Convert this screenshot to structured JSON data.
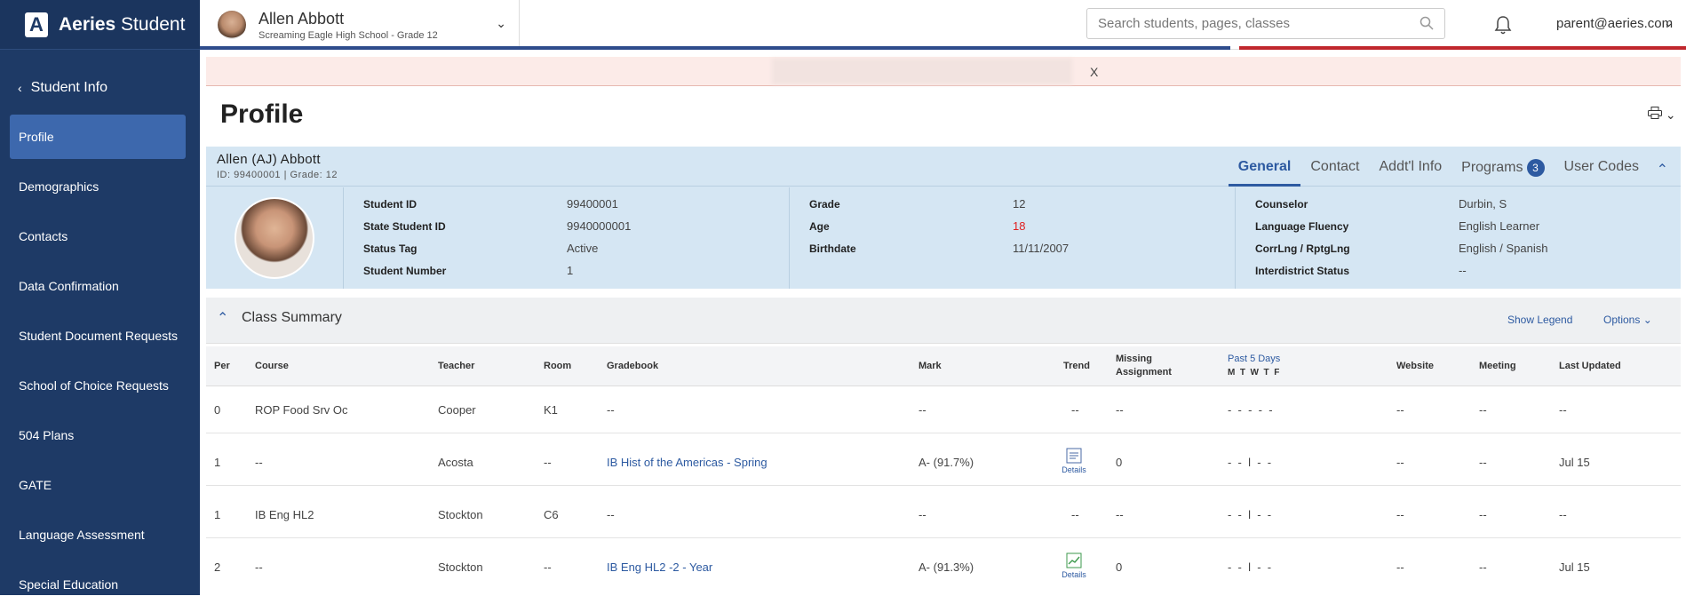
{
  "app": {
    "logo_letter": "A",
    "name_bold": "Aeries",
    "name_rest": " Student"
  },
  "sidebar": {
    "back_label": "Student Info",
    "items": [
      {
        "label": "Profile",
        "active": true
      },
      {
        "label": "Demographics"
      },
      {
        "label": "Contacts"
      },
      {
        "label": "Data Confirmation"
      },
      {
        "label": "Student Document Requests"
      },
      {
        "label": "School of Choice Requests"
      },
      {
        "label": "504 Plans"
      },
      {
        "label": "GATE"
      },
      {
        "label": "Language Assessment"
      },
      {
        "label": "Special Education"
      }
    ]
  },
  "header": {
    "student_name": "Allen Abbott",
    "student_sub": "Screaming Eagle High School - Grade 12",
    "search_placeholder": "Search students, pages, classes",
    "user_email": "parent@aeries.com"
  },
  "alert": {
    "close": "X"
  },
  "page": {
    "title": "Profile"
  },
  "card": {
    "name": "Allen (AJ) Abbott",
    "id_line": "ID: 99400001 |  Grade: 12",
    "tabs": [
      "General",
      "Contact",
      "Addt'l Info",
      "Programs",
      "User Codes"
    ],
    "programs_count": "3",
    "col1": [
      {
        "label": "Student ID",
        "value": "99400001"
      },
      {
        "label": "State Student ID",
        "value": "9940000001"
      },
      {
        "label": "Status Tag",
        "value": "Active"
      },
      {
        "label": "Student Number",
        "value": "1"
      }
    ],
    "col2": [
      {
        "label": "Grade",
        "value": "12"
      },
      {
        "label": "Age",
        "value": "18"
      },
      {
        "label": "Birthdate",
        "value": "11/11/2007"
      }
    ],
    "col3": [
      {
        "label": "Counselor",
        "value": "Durbin, S"
      },
      {
        "label": "Language Fluency",
        "value": "English Learner"
      },
      {
        "label": "CorrLng / RptgLng",
        "value": "English / Spanish"
      },
      {
        "label": "Interdistrict Status",
        "value": "--"
      }
    ],
    "age_color": "#e02020"
  },
  "summary": {
    "title": "Class Summary",
    "show_legend": "Show Legend",
    "options": "Options",
    "headers": {
      "per": "Per",
      "course": "Course",
      "teacher": "Teacher",
      "room": "Room",
      "gradebook": "Gradebook",
      "mark": "Mark",
      "trend": "Trend",
      "missing_1": "Missing",
      "missing_2": "Assignment",
      "past5": "Past 5 Days",
      "days": "M  T  W  T  F",
      "website": "Website",
      "meeting": "Meeting",
      "last_updated": "Last Updated"
    },
    "rows": [
      {
        "per": "0",
        "course": "ROP Food Srv Oc",
        "teacher": "Cooper",
        "room": "K1",
        "gradebook": "--",
        "mark": "--",
        "trend": "--",
        "missing": "--",
        "days": "-  -  -  -  -",
        "website": "--",
        "meeting": "--",
        "updated": "--"
      },
      {
        "per": "1",
        "course": "--",
        "teacher": "Acosta",
        "room": "--",
        "gradebook": "IB Hist of the Americas - Spring",
        "mark": "A- (91.7%)",
        "trend": "Details",
        "trend_icon": "document-icon",
        "missing": "0",
        "days": "-  -  l  -  -",
        "website": "--",
        "meeting": "--",
        "updated": "Jul 15"
      },
      {
        "per": "1",
        "course": "IB Eng HL2",
        "teacher": "Stockton",
        "room": "C6",
        "gradebook": "--",
        "mark": "--",
        "trend": "--",
        "missing": "--",
        "days": "-  -  l  -  -",
        "website": "--",
        "meeting": "--",
        "updated": "--"
      },
      {
        "per": "2",
        "course": "--",
        "teacher": "Stockton",
        "room": "--",
        "gradebook": "IB Eng HL2 -2 - Year",
        "mark": "A- (91.3%)",
        "trend": "Details",
        "trend_icon": "trend-chart-icon",
        "missing": "0",
        "days": "-  -  l  -  -",
        "website": "--",
        "meeting": "--",
        "updated": "Jul 15"
      }
    ]
  },
  "colors": {
    "sidebar": "#1e3a66",
    "active": "#3d68ad",
    "accent": "#2d5aa1",
    "card": "#d5e6f3",
    "alert": "#fcebe8",
    "stripe_red": "#c0272d"
  }
}
